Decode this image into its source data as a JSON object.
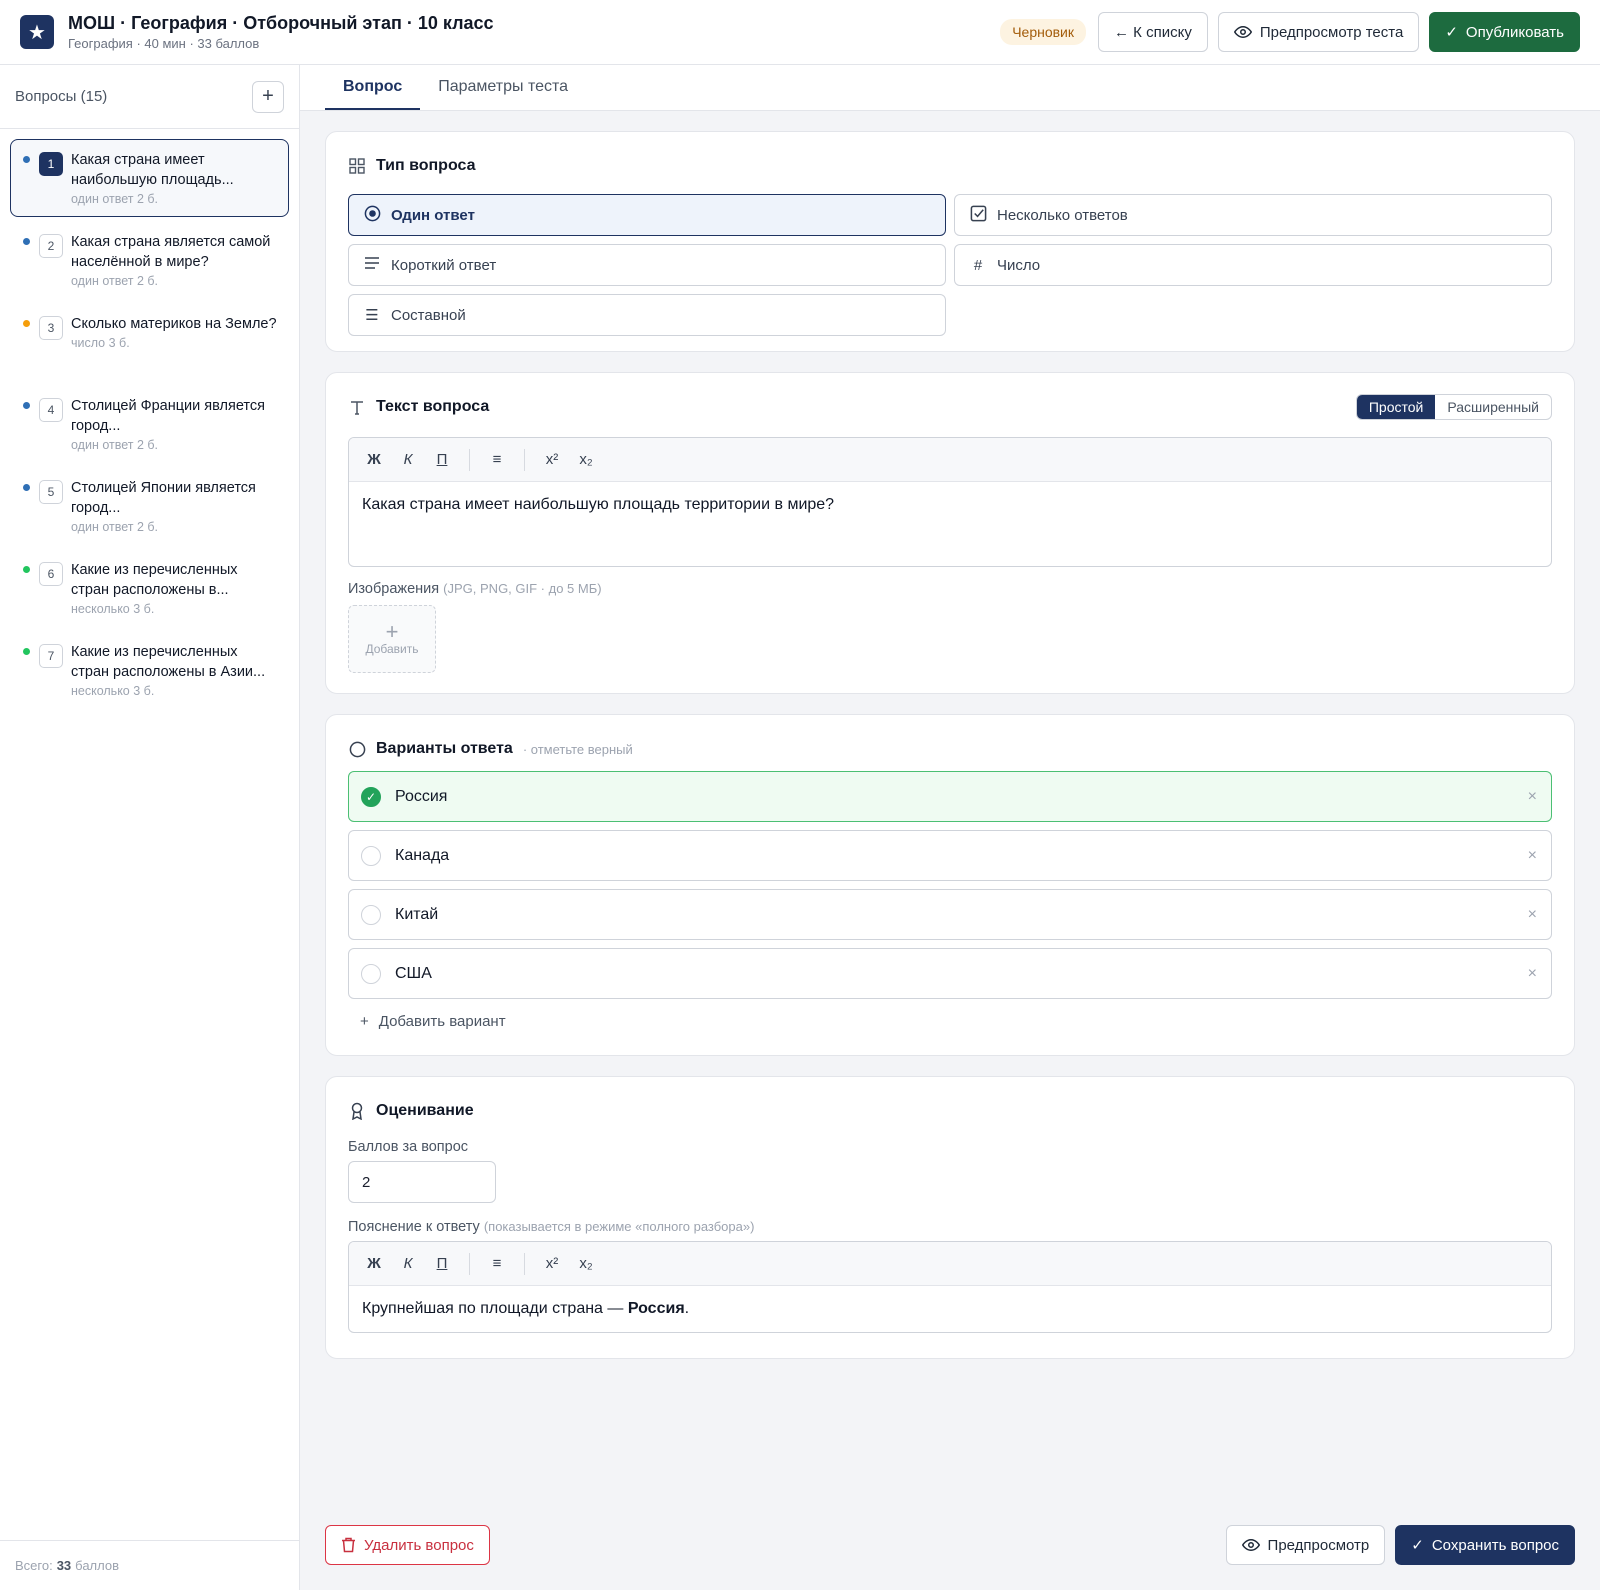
{
  "header": {
    "logo_icon": "star-icon",
    "title": "МОШ · География · Отборочный этап · 10 класс",
    "subtitle": "География · 40 мин · 33 баллов",
    "status_badge": "Черновик",
    "back_label": "← К списку",
    "preview_label": "Предпросмотр теста",
    "publish_label": "Опубликовать"
  },
  "sidebar": {
    "title": "Вопросы (15)",
    "add_label": "+",
    "items": [
      {
        "num": "1",
        "text": "Какая страна имеет наибольшую площадь...",
        "meta": "один ответ  2 б.",
        "dot": "#2f6fb5",
        "active": true
      },
      {
        "num": "2",
        "text": "Какая страна является самой населённой в мире?",
        "meta": "один ответ  2 б.",
        "dot": "#2f6fb5"
      },
      {
        "num": "3",
        "text": "Сколько материков на Земле?",
        "meta": "число  3 б.",
        "dot": "#f59e0b"
      },
      {
        "num": "4",
        "text": "Столицей Франции является город...",
        "meta": "один ответ  2 б.",
        "dot": "#2f6fb5"
      },
      {
        "num": "5",
        "text": "Столицей Японии является город...",
        "meta": "один ответ  2 б.",
        "dot": "#2f6fb5"
      },
      {
        "num": "6",
        "text": "Какие из перечисленных стран расположены в...",
        "meta": "несколько  3 б.",
        "dot": "#22c55e"
      },
      {
        "num": "7",
        "text": "Какие из перечисленных стран расположены в Азии...",
        "meta": "несколько  3 б.",
        "dot": "#22c55e"
      }
    ],
    "footer_prefix": "Всего:",
    "footer_total": "33",
    "footer_suffix": "баллов"
  },
  "tabs": [
    {
      "label": "Вопрос",
      "active": true
    },
    {
      "label": "Параметры теста",
      "active": false
    }
  ],
  "question_type": {
    "heading": "Тип вопроса",
    "options": [
      {
        "label": "Один ответ",
        "icon": "radio-target-icon",
        "selected": true
      },
      {
        "label": "Несколько ответов",
        "icon": "checkbox-icon"
      },
      {
        "label": "Короткий ответ",
        "icon": "lines-icon"
      },
      {
        "label": "Число",
        "icon": "hash-icon"
      },
      {
        "label": "Составной",
        "icon": "list-icon"
      }
    ]
  },
  "question_text": {
    "heading": "Текст вопроса",
    "mode_simple": "Простой",
    "mode_extended": "Расширенный",
    "toolbar": {
      "bold": "Ж",
      "italic": "К",
      "underline": "П",
      "list": "≡",
      "sup": "x²",
      "sub": "x₂"
    },
    "body": "Какая страна имеет наибольшую площадь территории в мире?",
    "images_label": "Изображения",
    "images_hint": "(JPG, PNG, GIF · до 5 МБ)",
    "images_add": "Добавить"
  },
  "answers": {
    "heading": "Варианты ответа",
    "hint": "· отметьте верный",
    "options": [
      {
        "text": "Россия",
        "correct": true
      },
      {
        "text": "Канада",
        "correct": false
      },
      {
        "text": "Китай",
        "correct": false
      },
      {
        "text": "США",
        "correct": false
      }
    ],
    "remove_symbol": "×",
    "add_label": "Добавить вариант"
  },
  "grading": {
    "heading": "Оценивание",
    "points_label": "Баллов за вопрос",
    "points_value": "2",
    "explanation_label": "Пояснение к ответу",
    "explanation_hint": "(показывается в режиме «полного разбора»)",
    "explanation_text": "Крупнейшая по площади страна — ",
    "explanation_bold": "Россия",
    "explanation_end": "."
  },
  "actions": {
    "delete_label": "Удалить вопрос",
    "preview_label": "Предпросмотр",
    "save_label": "Сохранить вопрос"
  }
}
